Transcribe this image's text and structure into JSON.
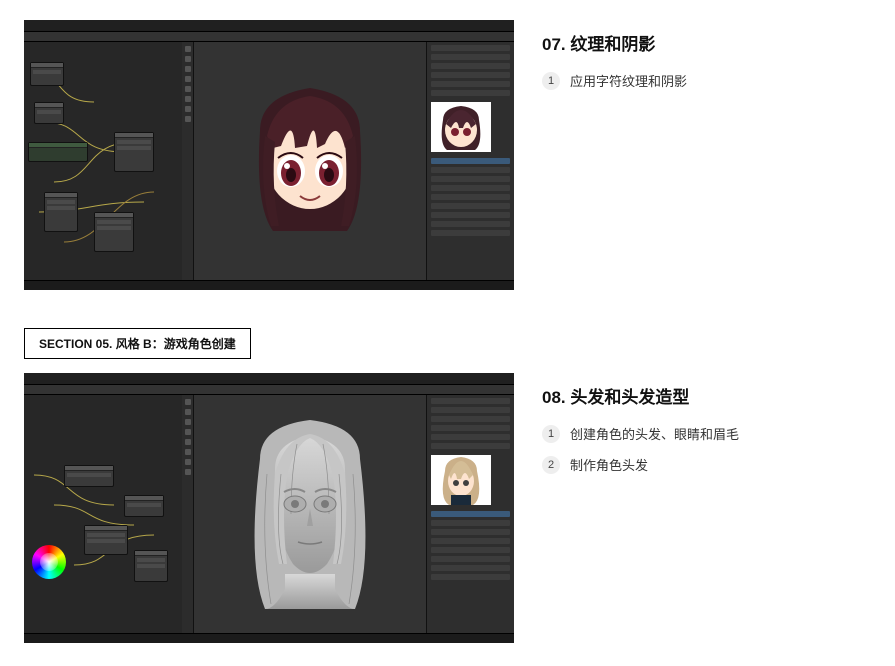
{
  "section07": {
    "title": "07. 纹理和阴影",
    "items": [
      "应用字符纹理和阴影"
    ]
  },
  "section_divider": {
    "label": "SECTION 05. 风格 B：游戏角色创建"
  },
  "section08": {
    "title": "08. 头发和头发造型",
    "items": [
      "创建角色的头发、眼睛和眉毛",
      "制作角色头发"
    ]
  },
  "nums": [
    "1",
    "2"
  ]
}
